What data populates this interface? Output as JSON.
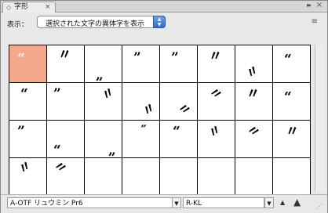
{
  "panel": {
    "tab_label": "字形",
    "tab_icon": "◇",
    "tab_close": "×",
    "collapse_icon": "▸▸",
    "window_close_icon": "×",
    "menu_icon": "≡"
  },
  "display": {
    "label": "表示：",
    "selected_option": "選択された文字の異体字を表示",
    "arrow": "▲▼"
  },
  "glyphs": [
    [
      "“",
      "〃",
      "„",
      "”",
      "”",
      "〃",
      "〃",
      "“"
    ],
    [
      "“",
      "”",
      "〃",
      "〃",
      "〃",
      "〃",
      "〃",
      "“"
    ],
    [
      "”",
      "“",
      "„",
      "˝",
      "“",
      "〃",
      "〃",
      "〃"
    ],
    [
      "〃",
      "〃",
      "",
      "",
      "",
      "",
      "",
      ""
    ]
  ],
  "bottom": {
    "font_name": "A-OTF リュウミン Pr6",
    "font_style": "R-KL",
    "dropdown_arrow": "▼",
    "zoom_out_icon": "▲",
    "zoom_in_icon": "▲",
    "resize_icon": "⋰"
  }
}
